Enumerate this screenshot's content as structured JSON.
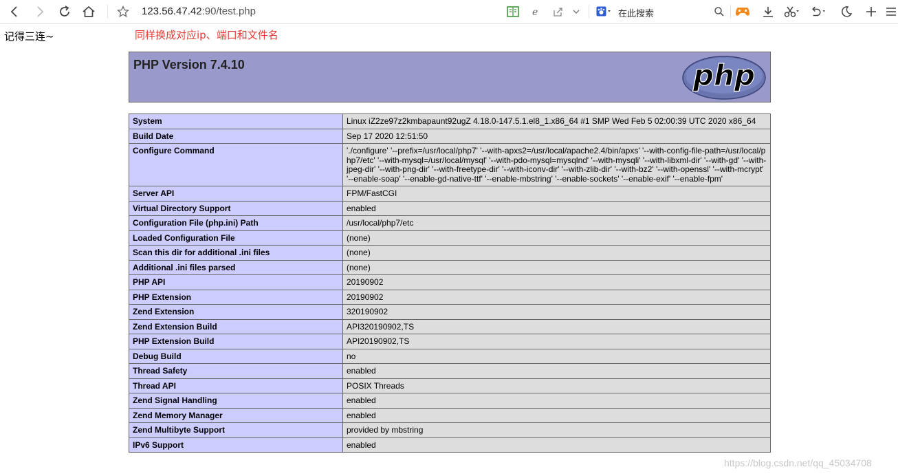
{
  "browser": {
    "url_host": "123.56.47.42",
    "url_rest": ":90/test.php",
    "search_placeholder": "在此搜索"
  },
  "page": {
    "note_left": "记得三连~",
    "note_red": "同样换成对应ip、端口和文件名",
    "php_title": "PHP Version 7.4.10",
    "logo_text": "php",
    "rows": [
      {
        "k": "System",
        "v": "Linux iZ2ze97z2kmbapaunt92ugZ 4.18.0-147.5.1.el8_1.x86_64 #1 SMP Wed Feb 5 02:00:39 UTC 2020 x86_64"
      },
      {
        "k": "Build Date",
        "v": "Sep 17 2020 12:51:50"
      },
      {
        "k": "Configure Command",
        "v": "'./configure' '--prefix=/usr/local/php7' '--with-apxs2=/usr/local/apache2.4/bin/apxs' '--with-config-file-path=/usr/local/php7/etc' '--with-mysql=/usr/local/mysql' '--with-pdo-mysql=mysqlnd' '--with-mysqli' '--with-libxml-dir' '--with-gd' '--with-jpeg-dir' '--with-png-dir' '--with-freetype-dir' '--with-iconv-dir' '--with-zlib-dir' '--with-bz2' '--with-openssl' '--with-mcrypt' '--enable-soap' '--enable-gd-native-ttf' '--enable-mbstring' '--enable-sockets' '--enable-exif' '--enable-fpm'"
      },
      {
        "k": "Server API",
        "v": "FPM/FastCGI"
      },
      {
        "k": "Virtual Directory Support",
        "v": "enabled"
      },
      {
        "k": "Configuration File (php.ini) Path",
        "v": "/usr/local/php7/etc"
      },
      {
        "k": "Loaded Configuration File",
        "v": "(none)"
      },
      {
        "k": "Scan this dir for additional .ini files",
        "v": "(none)"
      },
      {
        "k": "Additional .ini files parsed",
        "v": "(none)"
      },
      {
        "k": "PHP API",
        "v": "20190902"
      },
      {
        "k": "PHP Extension",
        "v": "20190902"
      },
      {
        "k": "Zend Extension",
        "v": "320190902"
      },
      {
        "k": "Zend Extension Build",
        "v": "API320190902,TS"
      },
      {
        "k": "PHP Extension Build",
        "v": "API20190902,TS"
      },
      {
        "k": "Debug Build",
        "v": "no"
      },
      {
        "k": "Thread Safety",
        "v": "enabled"
      },
      {
        "k": "Thread API",
        "v": "POSIX Threads"
      },
      {
        "k": "Zend Signal Handling",
        "v": "enabled"
      },
      {
        "k": "Zend Memory Manager",
        "v": "enabled"
      },
      {
        "k": "Zend Multibyte Support",
        "v": "provided by mbstring"
      },
      {
        "k": "IPv6 Support",
        "v": "enabled"
      }
    ],
    "watermark": "https://blog.csdn.net/qq_45034708"
  }
}
